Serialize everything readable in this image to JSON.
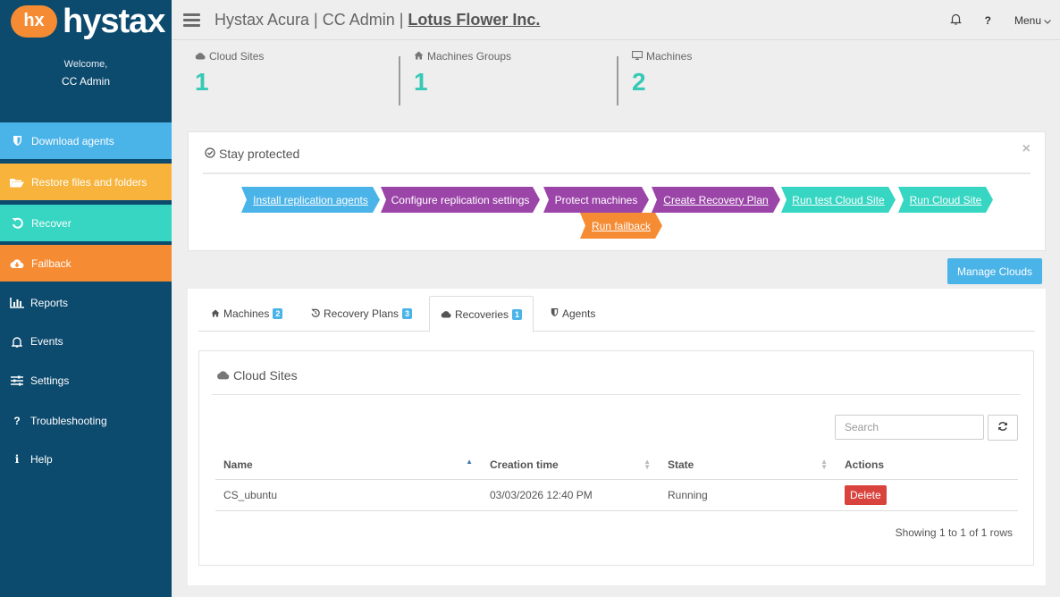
{
  "brand": {
    "logo_mark": "hx",
    "name": "hystax"
  },
  "sidebar": {
    "welcome": "Welcome,",
    "user": "CC Admin",
    "items": [
      {
        "label": "Download agents",
        "icon": "shield-icon",
        "color": "#4ab3e8"
      },
      {
        "label": "Restore files and folders",
        "icon": "folder-open-icon",
        "color": "#f7b33b"
      },
      {
        "label": "Recover",
        "icon": "undo-icon",
        "color": "#36d6c3"
      },
      {
        "label": "Failback",
        "icon": "cloud-download-icon",
        "color": "#f58b33"
      }
    ],
    "plain_items": [
      {
        "label": "Reports",
        "icon": "bar-chart-icon"
      },
      {
        "label": "Events",
        "icon": "bell-icon"
      },
      {
        "label": "Settings",
        "icon": "sliders-icon"
      },
      {
        "label": "Troubleshooting",
        "icon": "question-icon"
      },
      {
        "label": "Help",
        "icon": "info-icon"
      }
    ]
  },
  "header": {
    "title_prefix": "Hystax Acura | CC Admin | ",
    "title_link": "Lotus Flower Inc.",
    "help": "?",
    "menu": "Menu"
  },
  "stats": [
    {
      "label": "Cloud Sites",
      "value": "1",
      "icon": "cloud-icon"
    },
    {
      "label": "Machines Groups",
      "value": "1",
      "icon": "home-icon"
    },
    {
      "label": "Machines",
      "value": "2",
      "icon": "monitor-icon"
    }
  ],
  "protect": {
    "title": "Stay protected",
    "steps": [
      {
        "label": "Install replication agents",
        "color": "#4ab3e8",
        "link": true
      },
      {
        "label": "Configure replication settings",
        "color": "#9b45a8",
        "link": false
      },
      {
        "label": "Protect machines",
        "color": "#9b45a8",
        "link": false
      },
      {
        "label": "Create Recovery Plan",
        "color": "#9b45a8",
        "link": true
      },
      {
        "label": "Run test Cloud Site",
        "color": "#36d6c3",
        "link": true
      },
      {
        "label": "Run Cloud Site",
        "color": "#36d6c3",
        "link": true
      },
      {
        "label": "Run failback",
        "color": "#f58b33",
        "link": true
      }
    ]
  },
  "manage_clouds": "Manage Clouds",
  "tabs": [
    {
      "label": "Machines",
      "badge": "2",
      "icon": "home-icon"
    },
    {
      "label": "Recovery Plans",
      "badge": "3",
      "icon": "history-icon"
    },
    {
      "label": "Recoveries",
      "badge": "1",
      "icon": "cloud-icon"
    },
    {
      "label": "Agents",
      "badge": "",
      "icon": "shield-icon"
    }
  ],
  "cloud_sites": {
    "title": "Cloud Sites",
    "search_placeholder": "Search",
    "columns": [
      "Name",
      "Creation time",
      "State",
      "Actions"
    ],
    "rows": [
      {
        "name": "CS_ubuntu",
        "created": "03/03/2026 12:40 PM",
        "state": "Running",
        "action": "Delete"
      }
    ],
    "pager": "Showing 1 to 1 of 1 rows"
  }
}
